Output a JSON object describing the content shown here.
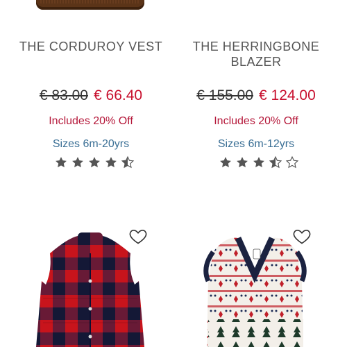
{
  "products_row_1": [
    {
      "title": "THE CORDUROY VEST",
      "old_price": "€ 83.00",
      "new_price": "€ 66.40",
      "discount": "Includes 20% Off",
      "sizes": "Sizes 6m-20yrs",
      "rating": 4.5
    },
    {
      "title": "THE HERRINGBONE BLAZER",
      "old_price": "€ 155.00",
      "new_price": "€ 124.00",
      "discount": "Includes 20% Off",
      "sizes": "Sizes 6m-12yrs",
      "rating": 3.5
    }
  ],
  "products_row_2": [
    {
      "wishlist_icon": "heart-outline-icon",
      "image": "red-navy-buffalo-check-puffer-vest"
    },
    {
      "wishlist_icon": "heart-outline-icon",
      "image": "fair-isle-knit-sweater-vest"
    }
  ],
  "colors": {
    "title": "#555555",
    "sale_price": "#c8102e",
    "discount": "#b5183a",
    "sizes": "#3a6f95",
    "stars": "#555555"
  }
}
